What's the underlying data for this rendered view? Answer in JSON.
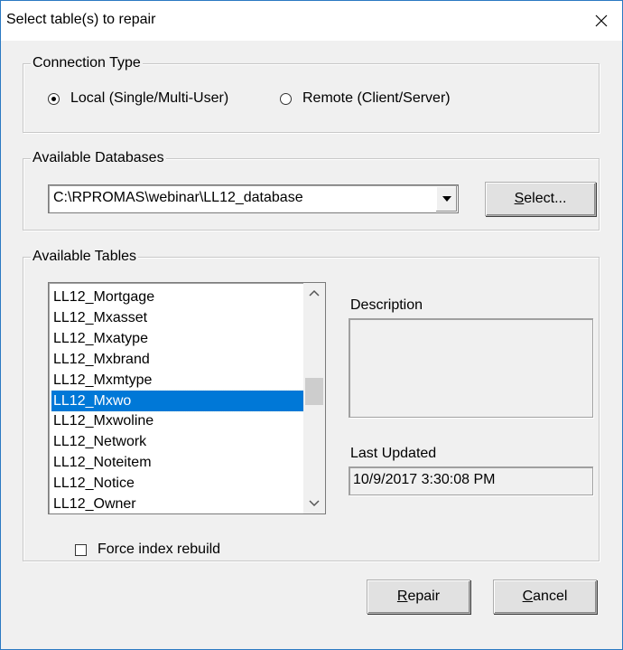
{
  "window": {
    "title": "Select table(s) to repair"
  },
  "connection": {
    "legend": "Connection Type",
    "local_label": "Local (Single/Multi-User)",
    "remote_label": "Remote (Client/Server)",
    "selected": "local"
  },
  "databases": {
    "legend": "Available Databases",
    "current_value": "C:\\RPROMAS\\webinar\\LL12_database",
    "select_button_label": "Select...",
    "select_button_mnemonic": "S"
  },
  "tables": {
    "legend": "Available Tables",
    "items": [
      "LL12_Mortgage",
      "LL12_Mxasset",
      "LL12_Mxatype",
      "LL12_Mxbrand",
      "LL12_Mxmtype",
      "LL12_Mxwo",
      "LL12_Mxwoline",
      "LL12_Network",
      "LL12_Noteitem",
      "LL12_Notice",
      "LL12_Owner"
    ],
    "selected_index": 5,
    "description_label": "Description",
    "description_value": "",
    "last_updated_label": "Last Updated",
    "last_updated_value": "10/9/2017 3:30:08 PM",
    "force_index_label": "Force index rebuild",
    "force_index_checked": false
  },
  "actions": {
    "repair_label": "Repair",
    "cancel_label": "Cancel"
  },
  "colors": {
    "selection": "#0078d7",
    "dialog_bg": "#f0f0f0",
    "border_accent": "#2b79c2"
  }
}
